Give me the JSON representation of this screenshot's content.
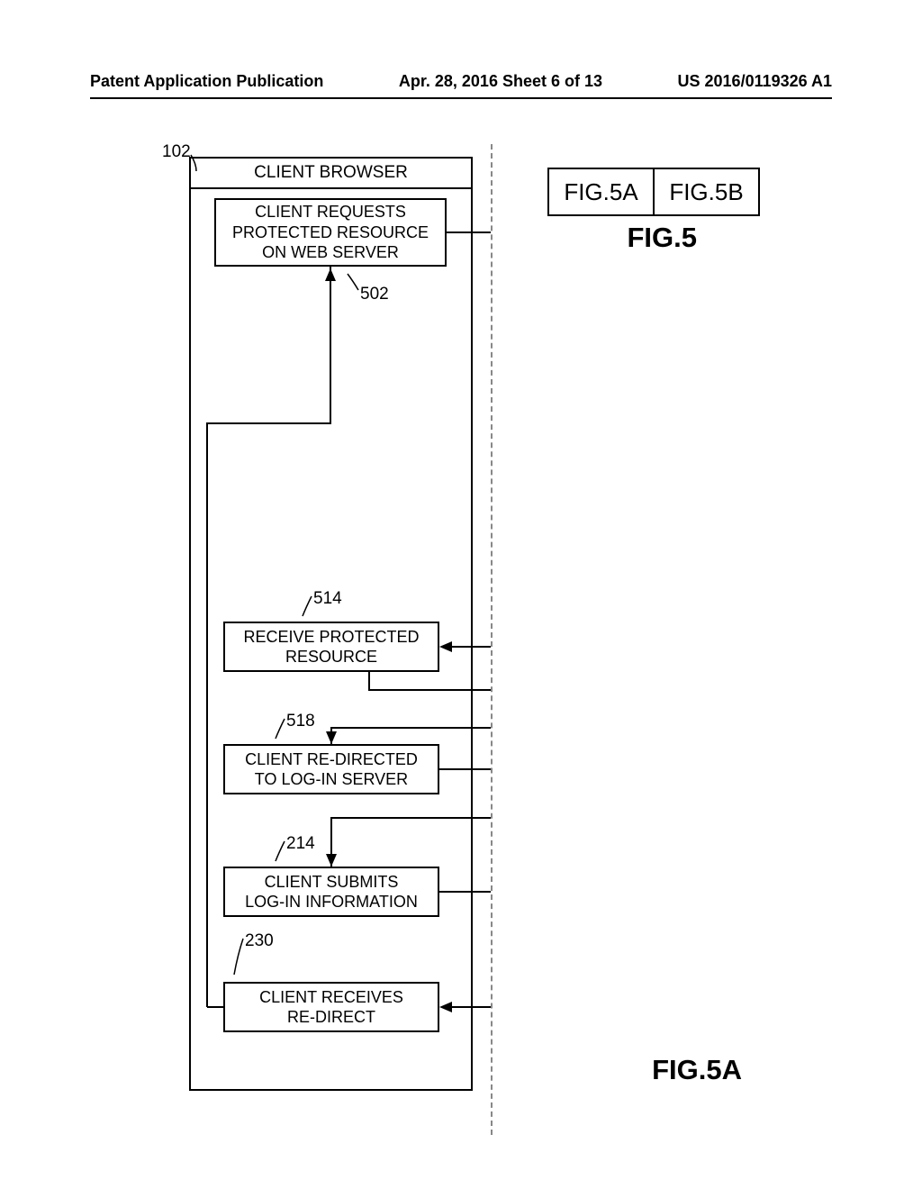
{
  "header": {
    "left": "Patent Application Publication",
    "center": "Apr. 28, 2016  Sheet 6 of 13",
    "right": "US 2016/0119326 A1"
  },
  "refs": {
    "r102": "102",
    "r502": "502",
    "r514": "514",
    "r518": "518",
    "r214": "214",
    "r230": "230"
  },
  "boxes": {
    "client_browser": "CLIENT BROWSER",
    "request": "CLIENT REQUESTS\nPROTECTED RESOURCE\nON WEB SERVER",
    "receive_resource": "RECEIVE PROTECTED\nRESOURCE",
    "redirect_login": "CLIENT RE-DIRECTED\nTO LOG-IN SERVER",
    "submit_login": "CLIENT SUBMITS\nLOG-IN INFORMATION",
    "receive_redirect": "CLIENT RECEIVES\nRE-DIRECT"
  },
  "figkey": {
    "a": "FIG.5A",
    "b": "FIG.5B"
  },
  "figlabels": {
    "fig5": "FIG.5",
    "fig5a": "FIG.5A"
  }
}
